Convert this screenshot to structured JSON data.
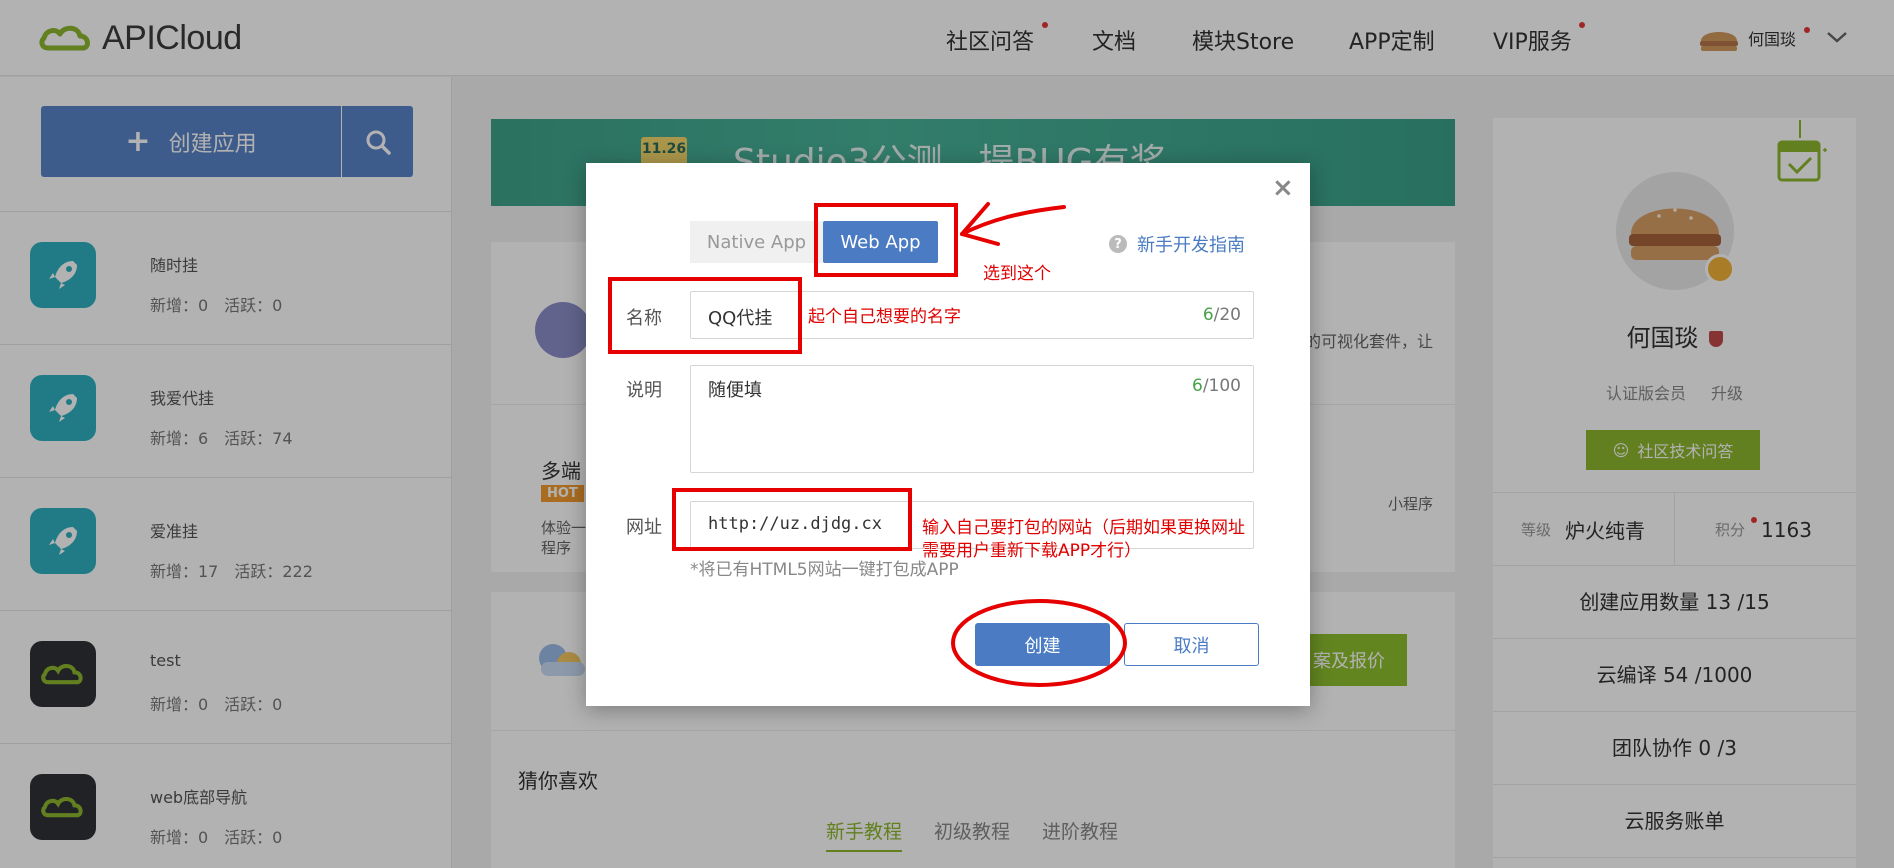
{
  "header": {
    "logo_text": "APICloud",
    "nav": [
      {
        "label": "社区问答",
        "dot": true
      },
      {
        "label": "文档",
        "dot": false
      },
      {
        "label": "模块Store",
        "dot": false
      },
      {
        "label": "APP定制",
        "dot": false
      },
      {
        "label": "VIP服务",
        "dot": true
      }
    ],
    "user_name": "何国琰"
  },
  "sidebar": {
    "create_label": "创建应用",
    "apps": [
      {
        "name": "随时挂",
        "stats": "新增：0　活跃：0",
        "icon": "rocket-icon",
        "color": "#2fb1c0"
      },
      {
        "name": "我爱代挂",
        "stats": "新增：6　活跃：74",
        "icon": "rocket-icon",
        "color": "#2fb1c0"
      },
      {
        "name": "爱准挂",
        "stats": "新增：17　活跃：222",
        "icon": "rocket-icon",
        "color": "#2fb1c0"
      },
      {
        "name": "test",
        "stats": "新增：0　活跃：0",
        "icon": "cloud-icon",
        "color": "#2f3235"
      },
      {
        "name": "web底部导航",
        "stats": "新增：0　活跃：0",
        "icon": "cloud-icon",
        "color": "#2f3235"
      }
    ]
  },
  "main": {
    "banner_date": "11.26",
    "banner_text": "Studio3公测，提BUG有奖",
    "panel1_text": "的可视化套件，让",
    "panel2_title": "多端",
    "panel2_hot": "HOT",
    "panel2_desc1": "体验一",
    "panel2_desc2": "程序",
    "panel2_right": "小程序",
    "panel3_btn": "案及报价",
    "guess_title": "猜你喜欢",
    "tabs": [
      "新手教程",
      "初级教程",
      "进阶教程"
    ]
  },
  "profile": {
    "name": "何国琰",
    "member": "认证版会员",
    "upgrade": "升级",
    "community_btn": "社区技术问答",
    "level_label": "等级",
    "level_value": "炉火纯青",
    "points_label": "积分",
    "points_value": "1163",
    "rows": [
      "创建应用数量  13 /15",
      "云编译  54 /1000",
      "团队协作  0 /3",
      "云服务账单"
    ]
  },
  "modal": {
    "close": "×",
    "type_native": "Native App",
    "type_web": "Web App",
    "guide": "新手开发指南",
    "name_label": "名称",
    "name_value": "QQ代挂",
    "name_count_cur": "6",
    "name_count_max": "/20",
    "desc_label": "说明",
    "desc_value": "随便填",
    "desc_count_cur": "6",
    "desc_count_max": "/100",
    "url_label": "网址",
    "url_value": "http://uz.djdg.cx",
    "hint": "*将已有HTML5网站一键打包成APP",
    "create": "创建",
    "cancel": "取消"
  },
  "annotations": {
    "select_this": "选到这个",
    "name_note": "起个自己想要的名字",
    "url_note1": "输入自己要打包的网站（后期如果更换网址",
    "url_note2": "需要用户重新下载APP才行）",
    "color": "#e60000"
  },
  "colors": {
    "primary": "#4a7bc3",
    "green": "#8fb82e",
    "teal": "#2fb1c0",
    "annotation": "#e60000"
  }
}
